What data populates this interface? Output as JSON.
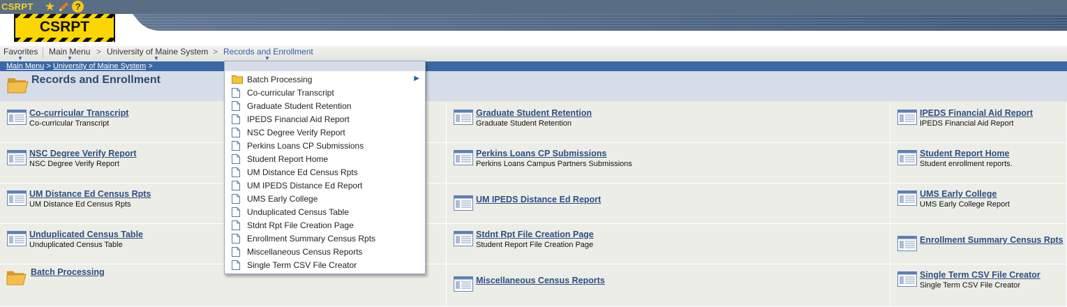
{
  "app": {
    "name": "CSRPT",
    "logo_text": "CSRPT"
  },
  "nav": {
    "items": [
      "Favorites",
      "Main Menu",
      "University of Maine System",
      "Records and Enrollment"
    ],
    "separator": ">"
  },
  "breadcrumb": {
    "items": [
      "Main Menu",
      "University of Maine System"
    ],
    "separator": ">"
  },
  "page": {
    "title": "Records and Enrollment"
  },
  "dropdown": {
    "items": [
      {
        "label": "Batch Processing",
        "type": "folder",
        "has_submenu": true
      },
      {
        "label": "Co-curricular Transcript",
        "type": "page"
      },
      {
        "label": "Graduate Student Retention",
        "type": "page"
      },
      {
        "label": "IPEDS Financial Aid Report",
        "type": "page"
      },
      {
        "label": "NSC Degree Verify Report",
        "type": "page"
      },
      {
        "label": "Perkins Loans CP Submissions",
        "type": "page"
      },
      {
        "label": "Student Report Home",
        "type": "page"
      },
      {
        "label": "UM Distance Ed Census Rpts",
        "type": "page"
      },
      {
        "label": "UM IPEDS Distance Ed Report",
        "type": "page"
      },
      {
        "label": "UMS Early College",
        "type": "page"
      },
      {
        "label": "Unduplicated Census Table",
        "type": "page"
      },
      {
        "label": "Stdnt Rpt File Creation Page",
        "type": "page"
      },
      {
        "label": "Enrollment Summary Census Rpts",
        "type": "page"
      },
      {
        "label": "Miscellaneous Census Reports",
        "type": "page"
      },
      {
        "label": "Single Term CSV File Creator",
        "type": "page"
      }
    ]
  },
  "grid": {
    "cells": [
      {
        "title": "Co-curricular Transcript",
        "desc": "Co-curricular Transcript",
        "icon": "report-icon"
      },
      {
        "title": "Graduate Student Retention",
        "desc": "Graduate Student Retention",
        "icon": "report-icon"
      },
      {
        "title": "IPEDS Financial Aid Report",
        "desc": "IPEDS Financial Aid Report",
        "icon": "report-icon"
      },
      {
        "title": "NSC Degree Verify Report",
        "desc": "NSC Degree Verify Report",
        "icon": "report-icon"
      },
      {
        "title": "Perkins Loans CP Submissions",
        "desc": "Perkins Loans Campus Partners Submissions",
        "icon": "report-icon"
      },
      {
        "title": "Student Report Home",
        "desc": "Student enrollment reports.",
        "icon": "report-icon"
      },
      {
        "title": "UM Distance Ed Census Rpts",
        "desc": "UM Distance Ed Census Rpts",
        "icon": "report-icon"
      },
      {
        "title": "UM IPEDS Distance Ed Report",
        "desc": "",
        "icon": "report-icon"
      },
      {
        "title": "UMS Early College",
        "desc": "UMS Early College Report",
        "icon": "report-icon"
      },
      {
        "title": "Unduplicated Census Table",
        "desc": "Unduplicated Census Table",
        "icon": "report-icon"
      },
      {
        "title": "Stdnt Rpt File Creation Page",
        "desc": "Student Report File Creation Page",
        "icon": "report-icon"
      },
      {
        "title": "Enrollment Summary Census Rpts",
        "desc": "",
        "icon": "report-icon"
      },
      {
        "title": "Batch Processing",
        "desc": "",
        "icon": "folder-icon"
      },
      {
        "title": "Miscellaneous Census Reports",
        "desc": "",
        "icon": "report-icon"
      },
      {
        "title": "Single Term CSV File Creator",
        "desc": "Single Term CSV File Creator",
        "icon": "report-icon"
      }
    ]
  },
  "colors": {
    "topbar": "#5a6e83",
    "accent_yellow": "#fbd602",
    "link": "#2c4f84",
    "crumb_bar": "#3a68a6",
    "title_band": "#d6dde9"
  }
}
